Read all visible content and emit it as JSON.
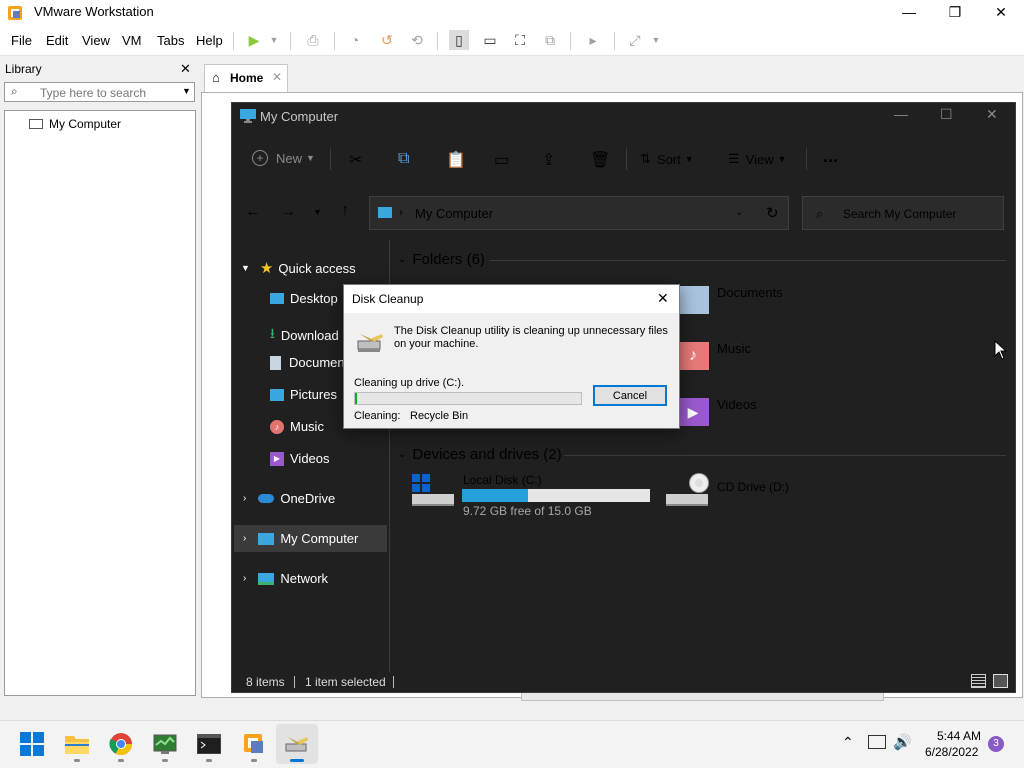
{
  "vmware": {
    "title": "VMware Workstation",
    "menu": [
      "File",
      "Edit",
      "View",
      "VM",
      "Tabs",
      "Help"
    ],
    "library": {
      "title": "Library",
      "search_placeholder": "Type here to search",
      "tree_item": "My Computer"
    },
    "tab": {
      "label": "Home"
    }
  },
  "explorer": {
    "title": "My Computer",
    "toolbar": {
      "new_label": "New",
      "sort_label": "Sort",
      "view_label": "View",
      "more": "..."
    },
    "address": {
      "path": "My Computer",
      "search_placeholder": "Search My Computer"
    },
    "nav": {
      "quick_access": "Quick access",
      "items": [
        "Desktop",
        "Download",
        "Documen",
        "Pictures",
        "Music",
        "Videos"
      ],
      "onedrive": "OneDrive",
      "my_computer": "My Computer",
      "network": "Network"
    },
    "folders": {
      "header": "Folders (6)",
      "items": [
        "Documents",
        "Music",
        "Videos"
      ]
    },
    "drives": {
      "header": "Devices and drives (2)",
      "local": {
        "name": "Local Disk (C:)",
        "free": "9.72 GB free of 15.0 GB",
        "used_fraction": 0.35
      },
      "cd": {
        "name": "CD Drive (D:)"
      }
    },
    "status": {
      "items": "8 items",
      "selected": "1 item selected"
    }
  },
  "dialog": {
    "title": "Disk Cleanup",
    "message": "The Disk Cleanup utility is cleaning up unnecessary files on your machine.",
    "progress_label": "Cleaning up drive  (C:).",
    "progress_fraction": 0.01,
    "cleaning_label": "Cleaning:",
    "cleaning_value": "Recycle Bin",
    "cancel": "Cancel"
  },
  "taskbar": {
    "time": "5:44 AM",
    "date": "6/28/2022",
    "notifications": "3"
  },
  "colors": {
    "accent": "#0078d4",
    "drive_bar": "#26a0da",
    "progress": "#06b025",
    "explorer_bg": "#202020"
  }
}
